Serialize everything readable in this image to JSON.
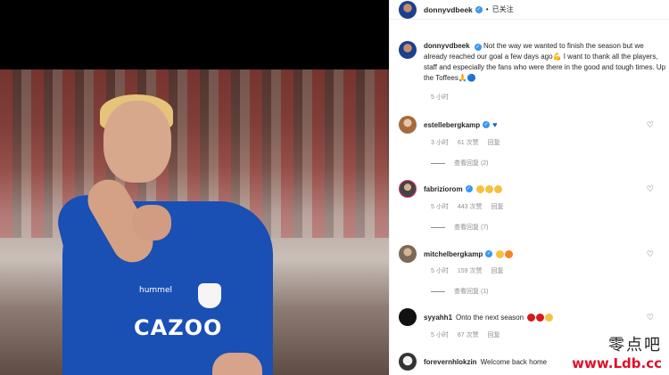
{
  "header": {
    "username": "donnyvdbeek",
    "separator": "•",
    "follow_status": "已关注"
  },
  "media": {
    "sponsor_text": "CAZOO",
    "kit_brand": "hummel"
  },
  "caption": {
    "username": "donnyvdbeek",
    "text": "Not the way we wanted to finish the season but we already reached our goal a few days ago💪 I want to thank all the players, staff and especially the fans who were there in the good and tough times. Up the Toffees🙏🔵",
    "time": "5 小时"
  },
  "comments": [
    {
      "username": "estellebergkamp",
      "text": "",
      "time": "3 小时",
      "likes": "61 次赞",
      "reply_label": "回复",
      "view_replies": "查看回复 (2)"
    },
    {
      "username": "fabriziorom",
      "text": "",
      "time": "5 小时",
      "likes": "443 次赞",
      "reply_label": "回复",
      "view_replies": "查看回复 (7)"
    },
    {
      "username": "mitchelbergkamp",
      "text": "",
      "time": "5 小时",
      "likes": "159 次赞",
      "reply_label": "回复",
      "view_replies": "查看回复 (1)"
    },
    {
      "username": "syyahh1",
      "text": "Onto the next season",
      "time": "5 小时",
      "likes": "87 次赞",
      "reply_label": "回复",
      "view_replies": ""
    },
    {
      "username": "forevernhlokzin",
      "text": "Welcome back home",
      "time": "",
      "likes": "",
      "reply_label": "",
      "view_replies": ""
    }
  ],
  "watermark": {
    "cn": "零点吧",
    "url": "www.Ldb.cc"
  },
  "colors": {
    "verified": "#3897f0",
    "kit_blue": "#1a4fb4",
    "watermark_red": "#e0102a",
    "muted_text": "#8e8e8e"
  },
  "icons": {
    "verified": "verified-badge-icon",
    "heart": "heart-icon",
    "flexed-biceps": "flexed-biceps-emoji-icon",
    "blue-heart": "blue-heart-emoji-icon",
    "clap": "clapping-hands-emoji-icon",
    "fire": "fire-emoji-icon",
    "red-circle": "red-circle-emoji-icon",
    "smile": "smile-emoji-icon"
  }
}
